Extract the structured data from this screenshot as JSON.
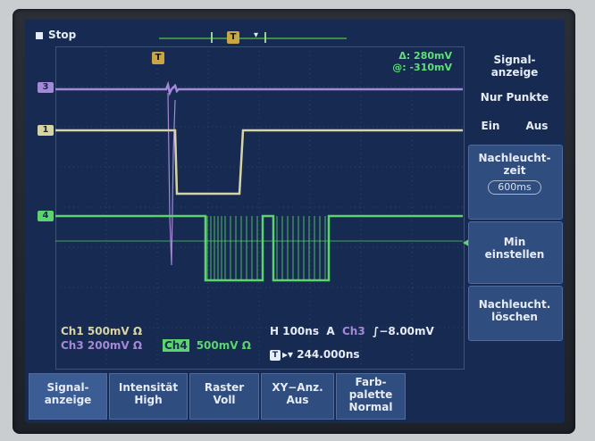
{
  "status": {
    "label": "Stop"
  },
  "trigger_marker": "T",
  "trigger_position_marker": "T",
  "cursor_readouts": {
    "delta": "Δ:   280mV",
    "at": "@:  -310mV"
  },
  "channel_markers": {
    "ch3": "3",
    "ch1": "1",
    "ch4": "4"
  },
  "channel_info": {
    "ch1": "Ch1   500mV Ω",
    "ch3": "Ch3   200mV Ω",
    "ch4_tag": "Ch4",
    "ch4": "500mV Ω"
  },
  "horizontal": {
    "timebase": "H  100ns",
    "trigger_mode": "A",
    "trigger_source": "Ch3",
    "trigger_level": "∫−8.00mV",
    "delay_icon": "T",
    "delay": "▸▾ 244.000ns"
  },
  "side_menu": {
    "title": "Signal-\nanzeige",
    "dots_only": "Nur Punkte",
    "on": "Ein",
    "off": "Aus",
    "persistence": "Nachleucht-\nzeit",
    "persistence_value": "600ms",
    "set_min": "Min\neinstellen",
    "clear_persistence": "Nachleucht.\nlöschen"
  },
  "bottom_menu": [
    {
      "label": "Signal-\nanzeige",
      "active": true
    },
    {
      "label": "Intensität\nHigh",
      "active": false
    },
    {
      "label": "Raster\nVoll",
      "active": false
    },
    {
      "label": "XY−Anz.\nAus",
      "active": false
    },
    {
      "label": "Farb-\npalette\nNormal",
      "active": false
    }
  ],
  "colors": {
    "screen_bg": "#172a52",
    "ch1": "#d7d4a4",
    "ch3": "#a389d6",
    "ch4": "#5cd46d",
    "menu_bg": "#2f4d7e"
  }
}
